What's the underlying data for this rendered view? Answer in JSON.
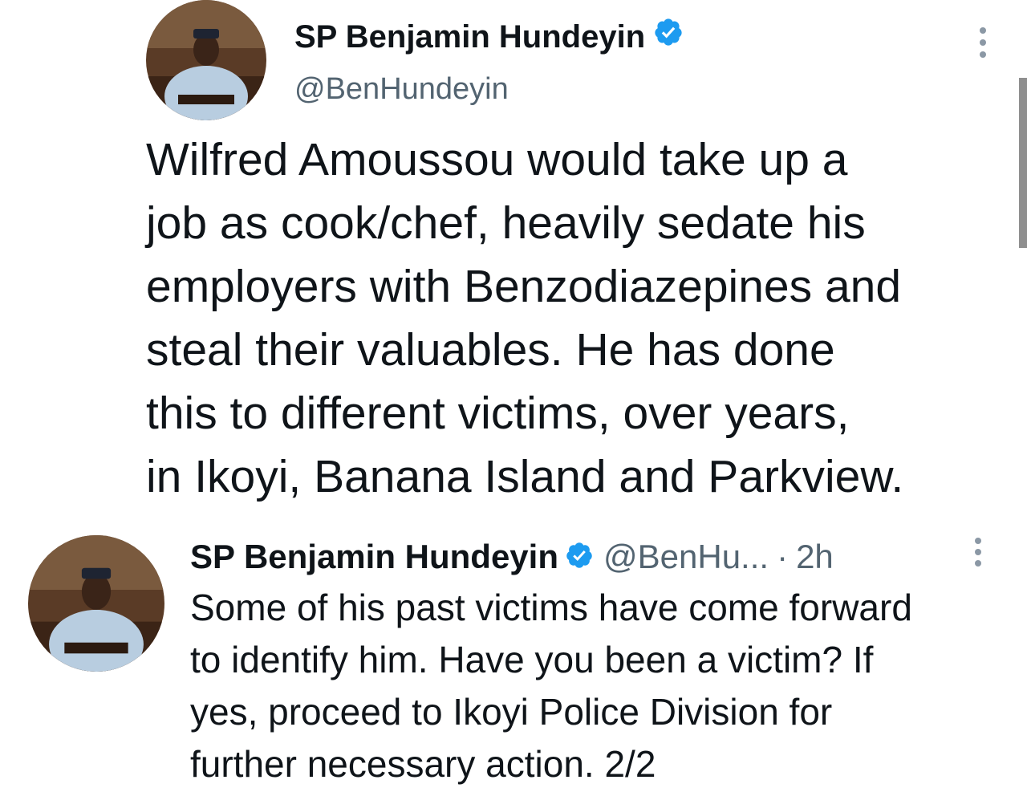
{
  "colors": {
    "text": "#0f1419",
    "secondary": "#536471",
    "verified": "#1d9bf0"
  },
  "main_tweet": {
    "author_name": "SP Benjamin Hundeyin",
    "handle": "@BenHundeyin",
    "avatar_icon": "user-avatar-photo",
    "verified_icon": "verified-badge-icon",
    "text_lines": [
      "Wilfred Amoussou would take up a",
      "job as cook/chef, heavily sedate his",
      "employers with Benzodiazepines and",
      "steal their valuables. He has done",
      "this to different victims, over years,",
      "in Ikoyi, Banana Island and Parkview."
    ]
  },
  "reply_tweet": {
    "author_name": "SP Benjamin Hundeyin",
    "handle": "@BenHu...",
    "separator": "·",
    "time": "2h",
    "text_lines": [
      "Some of his past victims have come forward",
      "to identify him. Have you been a victim? If",
      "yes, proceed to Ikoyi Police Division for",
      "further necessary action. 2/2"
    ]
  }
}
